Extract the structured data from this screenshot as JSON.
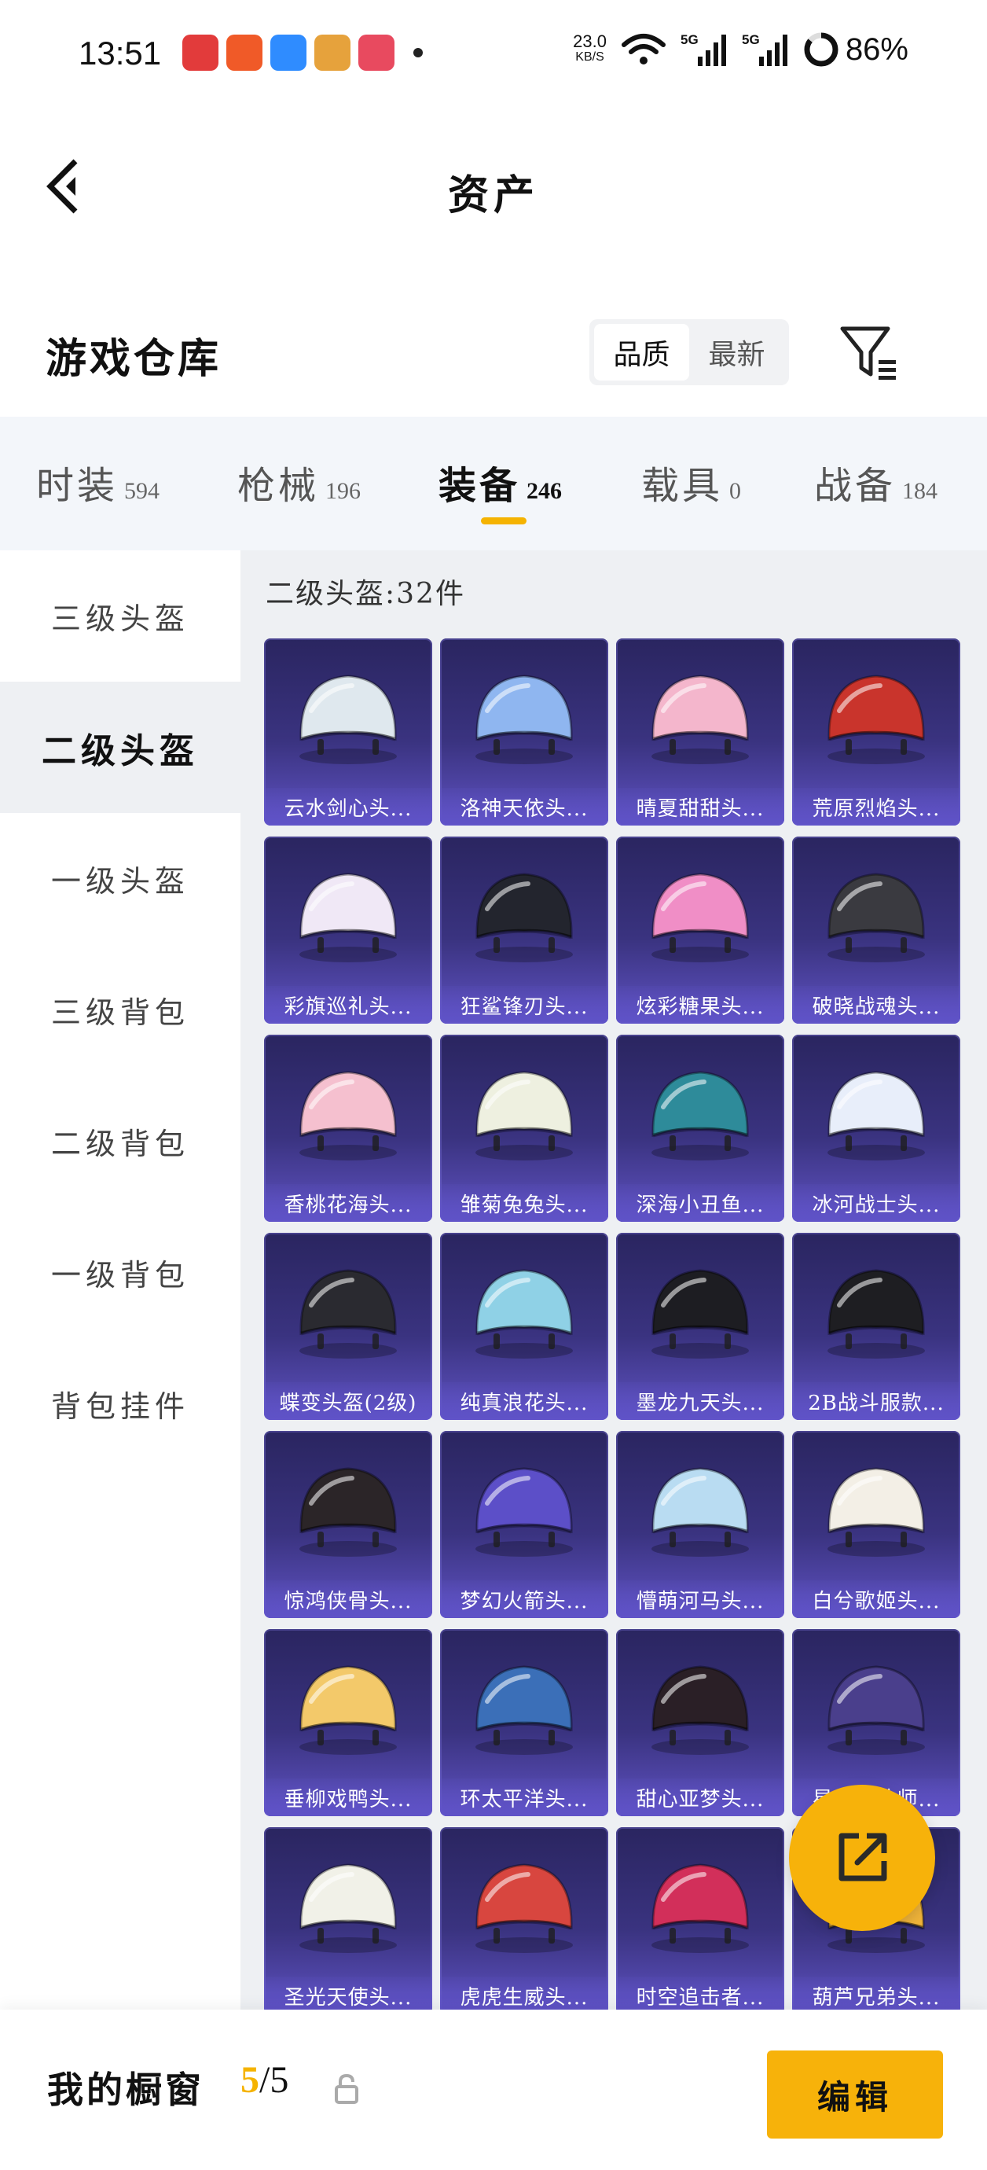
{
  "status_bar": {
    "time": "13:51",
    "net_speed": "23.0",
    "net_unit": "KB/S",
    "signal_1": "5G",
    "signal_2": "5G",
    "battery": "86%"
  },
  "header": {
    "title": "资产"
  },
  "section": {
    "title": "游戏仓库",
    "sort_options": [
      "品质",
      "最新"
    ],
    "sort_selected": "品质"
  },
  "categories": [
    {
      "name": "时装",
      "count": "594"
    },
    {
      "name": "枪械",
      "count": "196"
    },
    {
      "name": "装备",
      "count": "246",
      "active": true
    },
    {
      "name": "载具",
      "count": "0"
    },
    {
      "name": "战备",
      "count": "184"
    }
  ],
  "sidebar": {
    "items": [
      "三级头盔",
      "二级头盔",
      "一级头盔",
      "三级背包",
      "二级背包",
      "一级背包",
      "背包挂件"
    ],
    "active": "二级头盔"
  },
  "grid": {
    "title": "二级头盔:32件",
    "items": [
      {
        "label": "云水剑心头...",
        "color": "#dfe8ee"
      },
      {
        "label": "洛神天依头...",
        "color": "#8fb6f0"
      },
      {
        "label": "晴夏甜甜头...",
        "color": "#f4b6cc"
      },
      {
        "label": "荒原烈焰头...",
        "color": "#c9342c"
      },
      {
        "label": "彩旗巡礼头...",
        "color": "#f0e8f6"
      },
      {
        "label": "狂鲨锋刃头...",
        "color": "#23252e"
      },
      {
        "label": "炫彩糖果头...",
        "color": "#f08ec6"
      },
      {
        "label": "破晓战魂头...",
        "color": "#3a3a40"
      },
      {
        "label": "香桃花海头...",
        "color": "#f5c0cf"
      },
      {
        "label": "雏菊兔兔头...",
        "color": "#eef0e0"
      },
      {
        "label": "深海小丑鱼...",
        "color": "#2e8b9a"
      },
      {
        "label": "冰河战士头...",
        "color": "#e8eefa"
      },
      {
        "label": "蝶变头盔(2级)",
        "color": "#2a2a30"
      },
      {
        "label": "纯真浪花头...",
        "color": "#8fd1e6"
      },
      {
        "label": "墨龙九天头...",
        "color": "#1d1d22"
      },
      {
        "label": "2B战斗服款...",
        "color": "#1e1e22"
      },
      {
        "label": "惊鸿侠骨头...",
        "color": "#2b2528"
      },
      {
        "label": "梦幻火箭头...",
        "color": "#5c4fc8"
      },
      {
        "label": "懵萌河马头...",
        "color": "#b9dcf2"
      },
      {
        "label": "白兮歌姬头...",
        "color": "#f3efe6"
      },
      {
        "label": "垂柳戏鸭头...",
        "color": "#f3c96a"
      },
      {
        "label": "环太平洋头...",
        "color": "#3b6fb8"
      },
      {
        "label": "甜心亚梦头...",
        "color": "#2a1f26"
      },
      {
        "label": "星辰魔法师...",
        "color": "#4a3f8c"
      },
      {
        "label": "圣光天使头...",
        "color": "#f1f1e8"
      },
      {
        "label": "虎虎生威头...",
        "color": "#d8463f"
      },
      {
        "label": "时空追击者...",
        "color": "#d22f5a"
      },
      {
        "label": "葫芦兄弟头...",
        "color": "#f0b43a"
      }
    ]
  },
  "bottom": {
    "showcase_label": "我的橱窗",
    "showcase_current": "5",
    "showcase_total": "/5",
    "edit_label": "编辑"
  },
  "colors": {
    "accent": "#f7b20a",
    "card_bg_top": "#2a2560",
    "card_bg_bottom": "#5f52c2",
    "panel_bg": "#eef0f3"
  }
}
